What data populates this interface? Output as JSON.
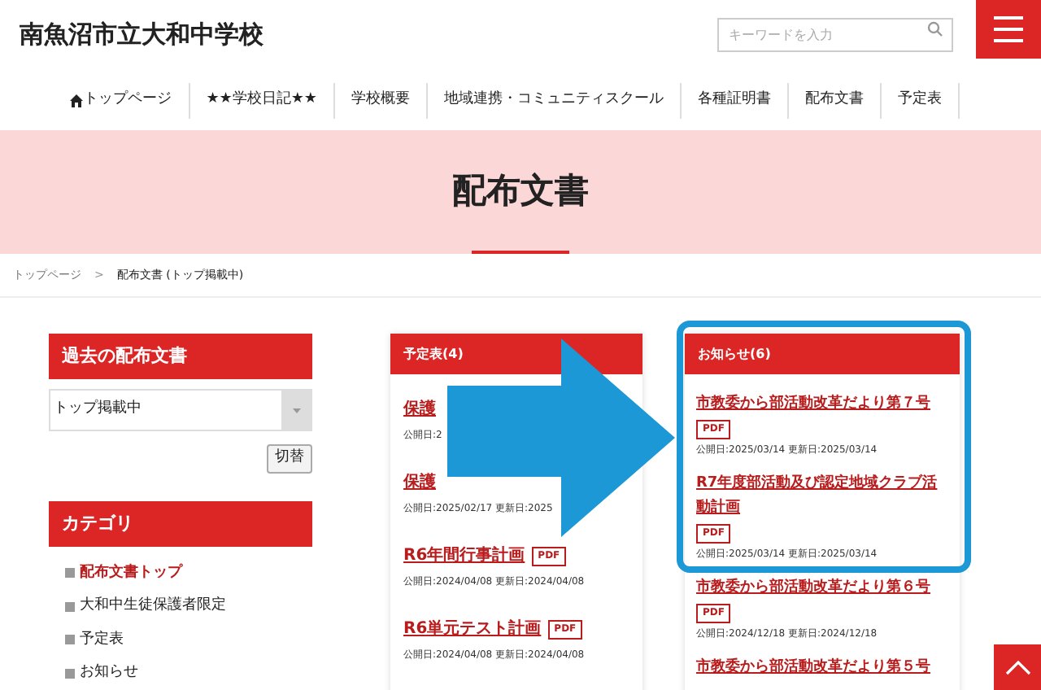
{
  "header": {
    "title": "南魚沼市立大和中学校",
    "search": {
      "placeholder": "キーワードを入力"
    }
  },
  "nav": [
    {
      "label": "トップページ",
      "kind": "home"
    },
    {
      "label": "★★学校日記★★",
      "kind": "plain"
    },
    {
      "label": "学校概要",
      "kind": "plain"
    },
    {
      "label": "地域連携・コミュニティスクール",
      "kind": "plain"
    },
    {
      "label": "各種証明書",
      "kind": "plain"
    },
    {
      "label": "配布文書",
      "kind": "plain"
    },
    {
      "label": "予定表",
      "kind": "plain"
    }
  ],
  "page_title": "配布文書",
  "breadcrumb": [
    {
      "kind": "link",
      "label": "トップページ"
    },
    {
      "kind": "separator",
      "label": ">"
    },
    {
      "kind": "current",
      "label": "配布文書 (トップ掲載中)"
    }
  ],
  "sidebar": {
    "archive": {
      "heading": "過去の配布文書",
      "select_value": "トップ掲載中",
      "button": "切替"
    },
    "category": {
      "heading": "カテゴリ",
      "items": [
        {
          "label": "配布文書トップ",
          "selected": true
        },
        {
          "label": "大和中生徒保護者限定",
          "selected": false
        },
        {
          "label": "予定表",
          "selected": false
        },
        {
          "label": "お知らせ",
          "selected": false
        }
      ]
    }
  },
  "cards": [
    {
      "heading": "予定表(4)",
      "highlighted": false,
      "items": [
        {
          "title": "保護",
          "dates": "公開日:2"
        },
        {
          "title": "保護",
          "dates": "公開日:2025/02/17 更新日:2025"
        },
        {
          "title": "R6年間行事計画",
          "badge": "PDF",
          "dates": "公開日:2024/04/08 更新日:2024/04/08"
        },
        {
          "title": "R6単元テスト計画",
          "badge": "PDF",
          "dates": "公開日:2024/04/08 更新日:2024/04/08"
        }
      ]
    },
    {
      "heading": "お知らせ(6)",
      "highlighted": true,
      "items": [
        {
          "title": "市教委から部活動改革だより第７号",
          "badge": "PDF",
          "dates": "公開日:2025/03/14 更新日:2025/03/14"
        },
        {
          "title": "R7年度部活動及び認定地域クラブ活動計画",
          "badge": "PDF",
          "dates": "公開日:2025/03/14 更新日:2025/03/14"
        },
        {
          "title": "市教委から部活動改革だより第６号",
          "badge": "PDF",
          "dates": "公開日:2024/12/18 更新日:2024/12/18"
        },
        {
          "title": "市教委から部活動改革だより第５号"
        }
      ]
    }
  ]
}
